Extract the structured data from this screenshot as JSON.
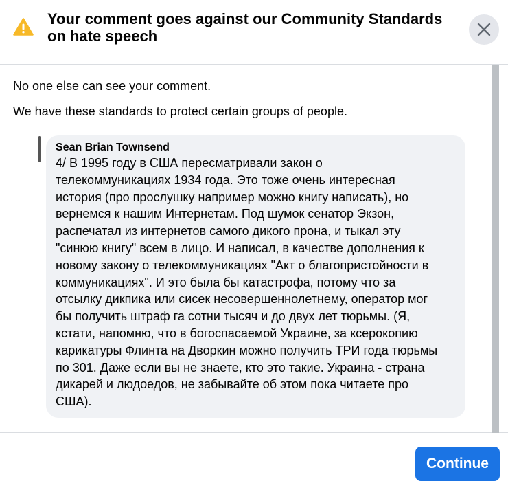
{
  "dialog": {
    "title": "Your comment goes against our Community Standards on hate speech",
    "warning_icon": "warning-triangle-icon",
    "close_icon": "close-icon"
  },
  "body": {
    "line1": "No one else can see your comment.",
    "line2": "We have these standards to protect certain groups of people."
  },
  "comment": {
    "author": "Sean Brian Townsend",
    "text": "4/ В 1995 году в США пересматривали закон о\nтелекоммуникациях 1934 года. Это тоже очень интересная\nистория (про прослушку например можно книгу написать), но\nвернемся к нашим Интернетам. Под шумок сенатор Экзон,\nраспечатал из интернетов самого дикого прона, и тыкал эту\n\"синюю книгу\" всем в лицо. И написал, в качестве дополнения к\nновому закону о телекоммуникациях \"Акт о благопристойности в\nкоммуникациях\". И это была бы катастрофа, потому что за\nотсылку дикпика или сисек несовершеннолетнему, оператор мог\nбы получить штраф га сотни тысяч и до двух лет тюрьмы. (Я,\nкстати, напомню, что в богоспасаемой Украине, за ксерокопию\nкарикатуры Флинта на Дворкин можно получить ТРИ года тюрьмы\nпо 301. Даже если вы не знаете, кто это такие. Украина - страна\nдикарей и людоедов, не забывайте об этом пока читаете про\nСША)."
  },
  "footer": {
    "continue_label": "Continue"
  },
  "colors": {
    "primary": "#1b74e4",
    "warning": "#f7b928",
    "bubble": "#f0f2f5",
    "close_bg": "#e4e6eb"
  }
}
